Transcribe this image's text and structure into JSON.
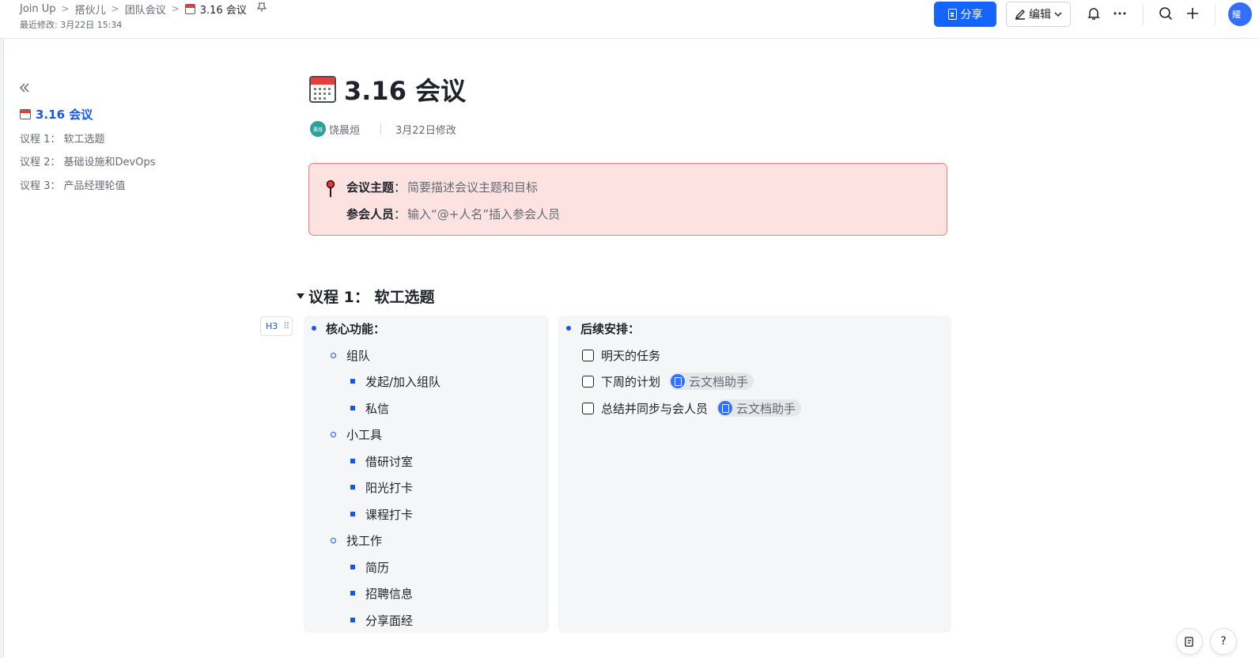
{
  "header": {
    "breadcrumb": [
      "Join Up",
      "搭伙儿",
      "团队会议"
    ],
    "current_doc": "3.16 会议",
    "last_modified": "最近修改: 3月22日 15:34",
    "share_label": "分享",
    "edit_label": "编辑",
    "avatar_text": "耀"
  },
  "outline": {
    "title": "3.16 会议",
    "items": [
      "议程 1： 软工选题",
      "议程 2： 基础设施和DevOps",
      "议程 3： 产品经理轮值"
    ]
  },
  "doc": {
    "title": "3.16 会议",
    "author_avatar": "晨煊",
    "author": "饶晨烜",
    "modified": "3月22日修改",
    "callout": {
      "topic_label": "会议主题",
      "topic_placeholder": "简要描述会议主题和目标",
      "attendees_label": "参会人员",
      "attendees_placeholder": "输入“@+人名”插入参会人员"
    },
    "section1": {
      "heading": "议程 1： 软工选题",
      "heading_tag": "H3",
      "left": {
        "title": "核心功能：",
        "groups": [
          {
            "name": "组队",
            "items": [
              "发起/加入组队",
              "私信"
            ]
          },
          {
            "name": "小工具",
            "items": [
              "借研讨室",
              "阳光打卡",
              "课程打卡"
            ]
          },
          {
            "name": "找工作",
            "items": [
              "简历",
              "招聘信息",
              "分享面经"
            ]
          }
        ]
      },
      "right": {
        "title": "后续安排：",
        "tasks": [
          {
            "text": "明天的任务",
            "assignee": ""
          },
          {
            "text": "下周的计划",
            "assignee": "云文档助手"
          },
          {
            "text": "总结并同步与会人员",
            "assignee": "云文档助手"
          }
        ]
      }
    }
  },
  "fab": {
    "help": "?"
  }
}
